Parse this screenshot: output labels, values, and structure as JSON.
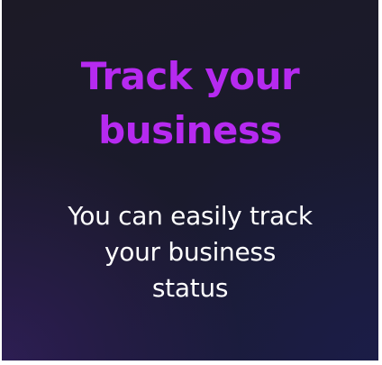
{
  "card": {
    "title_lines": [
      "Track your",
      "business"
    ],
    "subtitle_lines": [
      "You can easily track",
      "your business",
      "status"
    ]
  },
  "colors": {
    "title": "#b62af0",
    "subtitle": "#ffffff",
    "background": "#1b1a2c"
  }
}
